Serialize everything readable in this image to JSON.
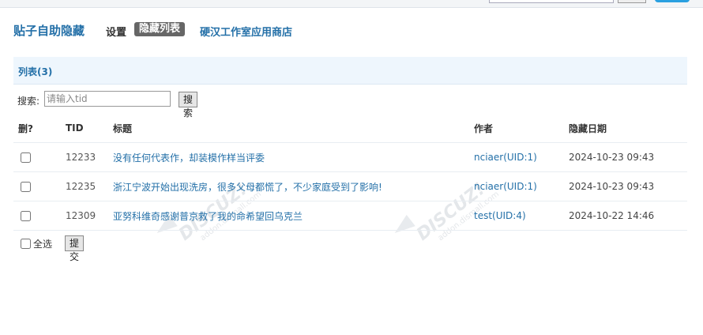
{
  "header": {
    "app_title": "贴子自助隐藏",
    "nav": [
      {
        "label": "设置",
        "active": false
      },
      {
        "label": "隐藏列表",
        "active": true
      },
      {
        "label": "硬汉工作室应用商店",
        "active": false
      }
    ]
  },
  "panel": {
    "title": "列表(3)"
  },
  "search": {
    "label": "搜索:",
    "placeholder": "请输入tid",
    "button_label": "搜索"
  },
  "table": {
    "headers": {
      "del": "删?",
      "tid": "TID",
      "title": "标题",
      "author": "作者",
      "date": "隐藏日期"
    },
    "rows": [
      {
        "tid": "12233",
        "title": "没有任何代表作，却装模作样当评委",
        "author": "nciaer(UID:1)",
        "date": "2024-10-23 09:43",
        "checked": false
      },
      {
        "tid": "12235",
        "title": "浙江宁波开始出现洗房，很多父母都慌了，不少家庭受到了影响!",
        "author": "nciaer(UID:1)",
        "date": "2024-10-23 09:43",
        "checked": false
      },
      {
        "tid": "12309",
        "title": "亚努科维奇感谢普京救了我的命希望回乌克兰",
        "author": "test(UID:4)",
        "date": "2024-10-22 14:46",
        "checked": false
      }
    ]
  },
  "footer": {
    "select_all_label": "全选",
    "submit_label": "提交"
  },
  "colors": {
    "accent": "#2470a8",
    "active_tab_bg": "#666666",
    "panel_bg": "#eef6fd"
  }
}
